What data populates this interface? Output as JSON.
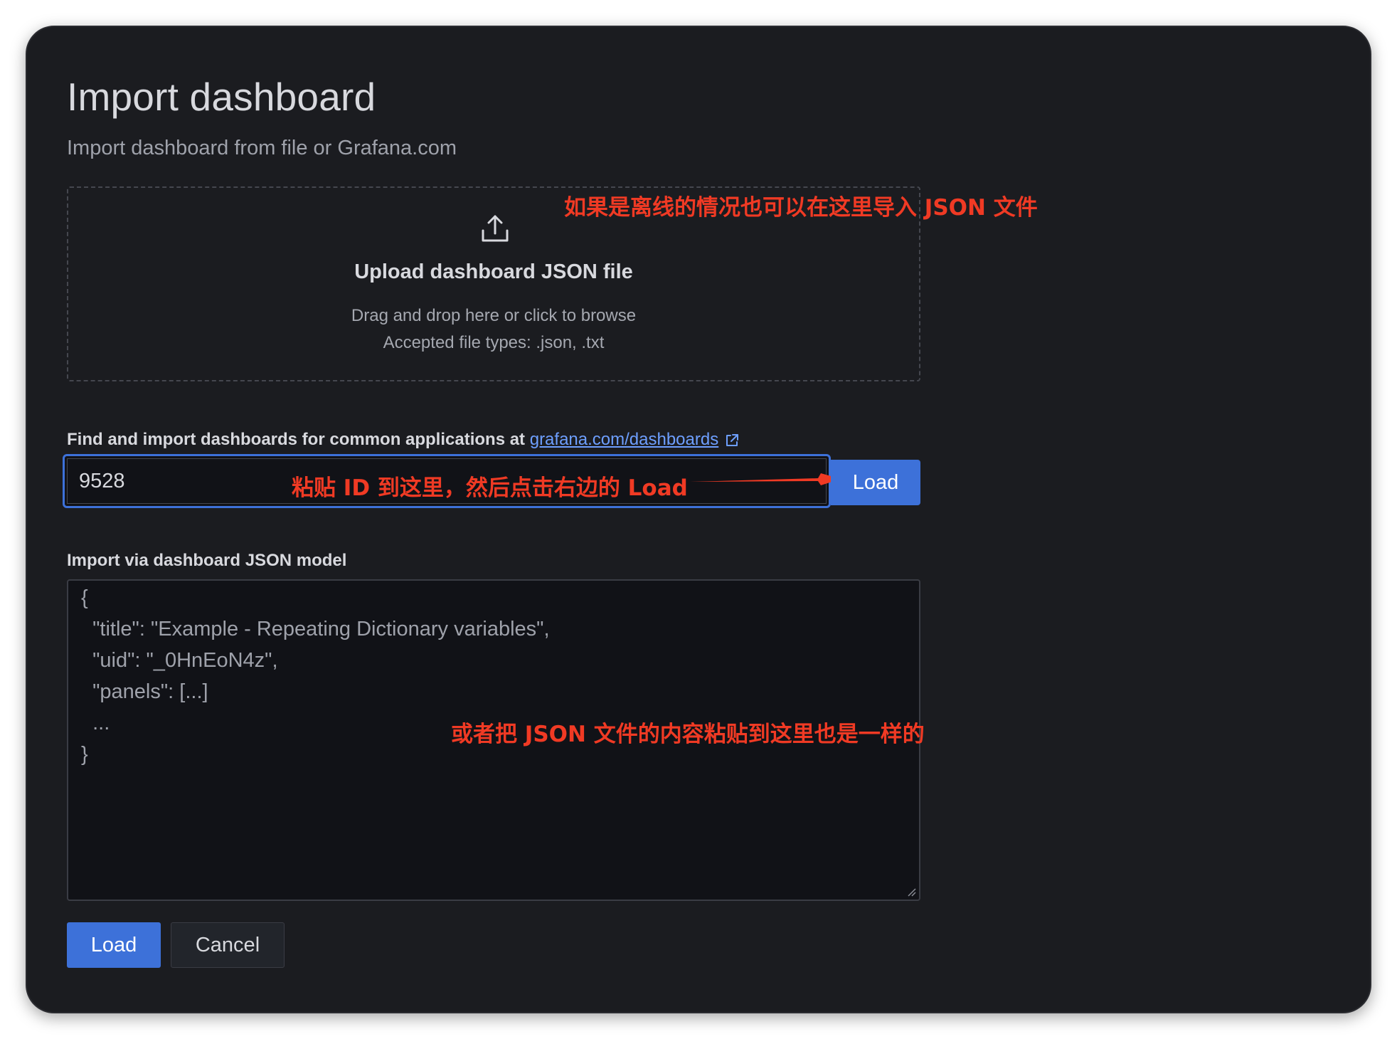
{
  "header": {
    "title": "Import dashboard",
    "subtitle": "Import dashboard from file or Grafana.com"
  },
  "upload": {
    "icon": "upload-icon",
    "title": "Upload dashboard JSON file",
    "hint": "Drag and drop here or click to browse",
    "types": "Accepted file types: .json, .txt"
  },
  "grafana_com": {
    "label": "Find and import dashboards for common applications at ",
    "link_text": "grafana.com/dashboards",
    "link_icon": "external-link-icon",
    "input_value": "9528",
    "load_label": "Load"
  },
  "json_model": {
    "label": "Import via dashboard JSON model",
    "placeholder_lines": [
      "{",
      "  \"title\": \"Example - Repeating Dictionary variables\",",
      "  \"uid\": \"_0HnEoN4z\",",
      "  \"panels\": [...]",
      "  ...",
      "}"
    ]
  },
  "annotations": {
    "offline": "如果是离线的情况也可以在这里导入 JSON 文件",
    "paste_id": "粘贴 ID 到这里，然后点击右边的 Load",
    "paste_json": "或者把 JSON 文件的内容粘贴到这里也是一样的",
    "color": "#f03a24"
  },
  "actions": {
    "load_label": "Load",
    "cancel_label": "Cancel"
  },
  "colors": {
    "background": "#1b1c20",
    "primary": "#3d71d9",
    "link": "#6e9fff",
    "text": "#d8d9de",
    "muted_text": "#9fa2ab"
  }
}
